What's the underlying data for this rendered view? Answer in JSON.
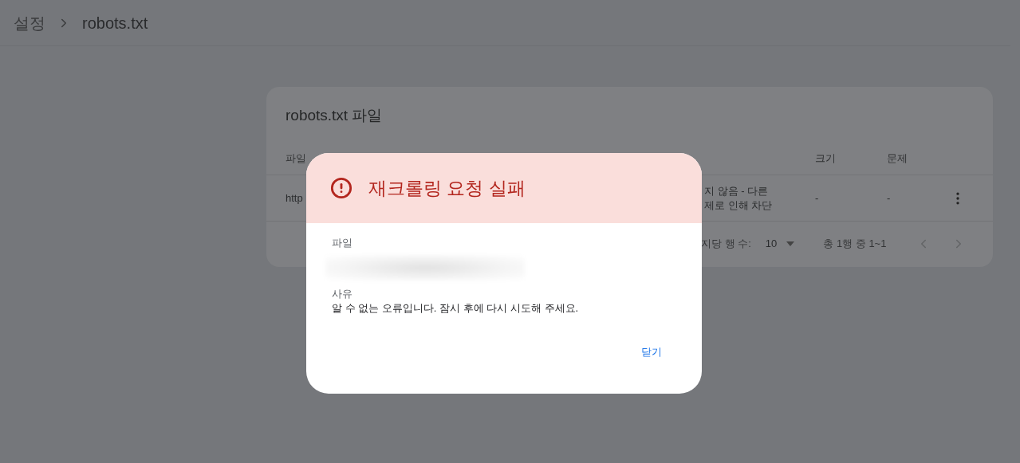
{
  "breadcrumb": [
    {
      "label": "설정"
    },
    {
      "label": "robots.txt"
    }
  ],
  "card": {
    "title": "robots.txt 파일",
    "columns": {
      "file": "파일",
      "size": "크기",
      "issues": "문제"
    },
    "rows": [
      {
        "file": "http",
        "status": [
          "지 않음 - 다른",
          "제로 인해 차단"
        ],
        "size": "-",
        "issues": "-"
      }
    ],
    "pagination": {
      "rows_label": "지당 행 수:",
      "rows_value": "10",
      "range": "총 1행 중 1~1"
    }
  },
  "dialog": {
    "title": "재크롤링 요청 실패",
    "fields": [
      {
        "kind": "redacted",
        "label": "파일"
      },
      {
        "kind": "text",
        "label": "사유",
        "value": "알 수 없는 오류입니다. 잠시 후에 다시 시도해 주세요."
      }
    ],
    "button": "닫기"
  }
}
